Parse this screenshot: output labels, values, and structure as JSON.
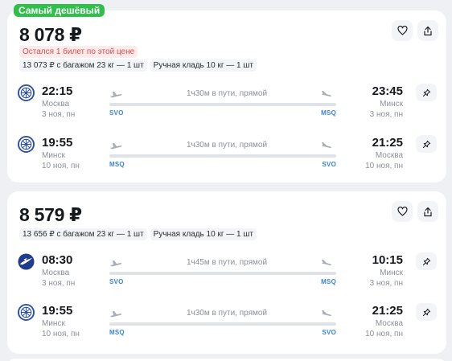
{
  "colors": {
    "background": "#eef0f4",
    "card": "#ffffff",
    "badge_green": "#2fbf4a",
    "warning_red": "#e04a4a",
    "airport_code_blue": "#3a84d6"
  },
  "cards": [
    {
      "badge": "Самый дешёвый",
      "price": "8 078 ₽",
      "warning": "Остался 1 билет по этой цене",
      "options": [
        "13 073 ₽ с багажом 23 кг — 1 шт",
        "Ручная кладь 10 кг — 1 шт"
      ],
      "like_icon": "heart-icon",
      "share_icon": "share-icon",
      "segments": [
        {
          "airline_logo": "airline-logo-circle-icon",
          "dep_time": "22:15",
          "dep_city": "Москва",
          "dep_date": "3 ноя, пн",
          "duration": "1ч30м в пути, прямой",
          "from_code": "SVO",
          "to_code": "MSQ",
          "arr_time": "23:45",
          "arr_city": "Минск",
          "arr_date": "3 ноя, пн",
          "pin_icon": "pin-icon"
        },
        {
          "airline_logo": "airline-logo-circle-icon",
          "dep_time": "19:55",
          "dep_city": "Минск",
          "dep_date": "10 ноя, пн",
          "duration": "1ч30м в пути, прямой",
          "from_code": "MSQ",
          "to_code": "SVO",
          "arr_time": "21:25",
          "arr_city": "Москва",
          "arr_date": "10 ноя, пн",
          "pin_icon": "pin-icon"
        }
      ]
    },
    {
      "price": "8 579 ₽",
      "options": [
        "13 656 ₽ с багажом 23 кг — 1 шт",
        "Ручная кладь 10 кг — 1 шт"
      ],
      "like_icon": "heart-icon",
      "share_icon": "share-icon",
      "segments": [
        {
          "airline_logo": "airline-logo-bird-icon",
          "dep_time": "08:30",
          "dep_city": "Москва",
          "dep_date": "3 ноя, пн",
          "duration": "1ч45м в пути, прямой",
          "from_code": "SVO",
          "to_code": "MSQ",
          "arr_time": "10:15",
          "arr_city": "Минск",
          "arr_date": "3 ноя, пн",
          "pin_icon": "pin-icon"
        },
        {
          "airline_logo": "airline-logo-circle-icon",
          "dep_time": "19:55",
          "dep_city": "Минск",
          "dep_date": "10 ноя, пн",
          "duration": "1ч30м в пути, прямой",
          "from_code": "MSQ",
          "to_code": "SVO",
          "arr_time": "21:25",
          "arr_city": "Москва",
          "arr_date": "10 ноя, пн",
          "pin_icon": "pin-icon"
        }
      ]
    }
  ]
}
